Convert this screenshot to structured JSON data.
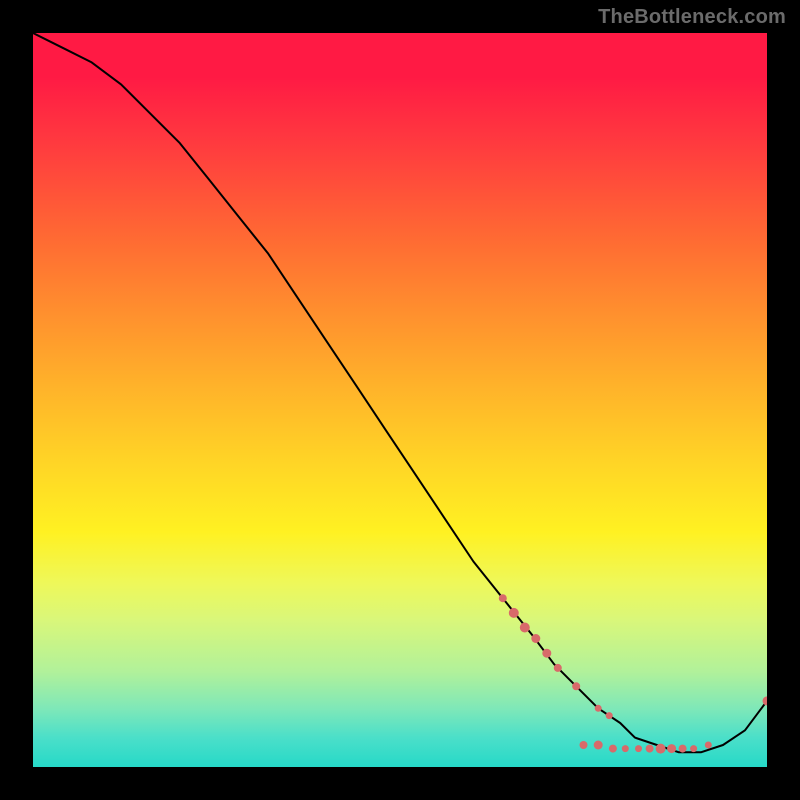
{
  "watermark": "TheBottleneck.com",
  "chart_data": {
    "type": "line",
    "title": "",
    "xlabel": "",
    "ylabel": "",
    "xlim": [
      0,
      100
    ],
    "ylim": [
      0,
      100
    ],
    "grid": false,
    "series": [
      {
        "name": "curve",
        "x": [
          0,
          4,
          8,
          12,
          16,
          20,
          24,
          28,
          32,
          36,
          40,
          44,
          48,
          52,
          56,
          60,
          64,
          68,
          71,
          74,
          77,
          80,
          82,
          85,
          88,
          91,
          94,
          97,
          100
        ],
        "y": [
          100,
          98,
          96,
          93,
          89,
          85,
          80,
          75,
          70,
          64,
          58,
          52,
          46,
          40,
          34,
          28,
          23,
          18,
          14,
          11,
          8,
          6,
          4,
          3,
          2,
          2,
          3,
          5,
          9
        ],
        "color": "#000000",
        "width": 2
      }
    ],
    "points": [
      {
        "x": 64.0,
        "y": 23.0,
        "r": 4.0
      },
      {
        "x": 65.5,
        "y": 21.0,
        "r": 5.0
      },
      {
        "x": 67.0,
        "y": 19.0,
        "r": 5.0
      },
      {
        "x": 68.5,
        "y": 17.5,
        "r": 4.5
      },
      {
        "x": 70.0,
        "y": 15.5,
        "r": 4.5
      },
      {
        "x": 71.5,
        "y": 13.5,
        "r": 4.0
      },
      {
        "x": 74.0,
        "y": 11.0,
        "r": 4.0
      },
      {
        "x": 77.0,
        "y": 8.0,
        "r": 3.5
      },
      {
        "x": 78.5,
        "y": 7.0,
        "r": 3.5
      },
      {
        "x": 75.0,
        "y": 3.0,
        "r": 4.0
      },
      {
        "x": 77.0,
        "y": 3.0,
        "r": 4.5
      },
      {
        "x": 79.0,
        "y": 2.5,
        "r": 4.0
      },
      {
        "x": 80.7,
        "y": 2.5,
        "r": 3.5
      },
      {
        "x": 82.5,
        "y": 2.5,
        "r": 3.5
      },
      {
        "x": 84.0,
        "y": 2.5,
        "r": 4.0
      },
      {
        "x": 85.5,
        "y": 2.5,
        "r": 5.0
      },
      {
        "x": 87.0,
        "y": 2.5,
        "r": 4.5
      },
      {
        "x": 88.5,
        "y": 2.5,
        "r": 4.0
      },
      {
        "x": 90.0,
        "y": 2.5,
        "r": 3.5
      },
      {
        "x": 92.0,
        "y": 3.0,
        "r": 3.5
      },
      {
        "x": 100.0,
        "y": 9.0,
        "r": 4.5
      }
    ],
    "point_color": "#d86a6a"
  }
}
